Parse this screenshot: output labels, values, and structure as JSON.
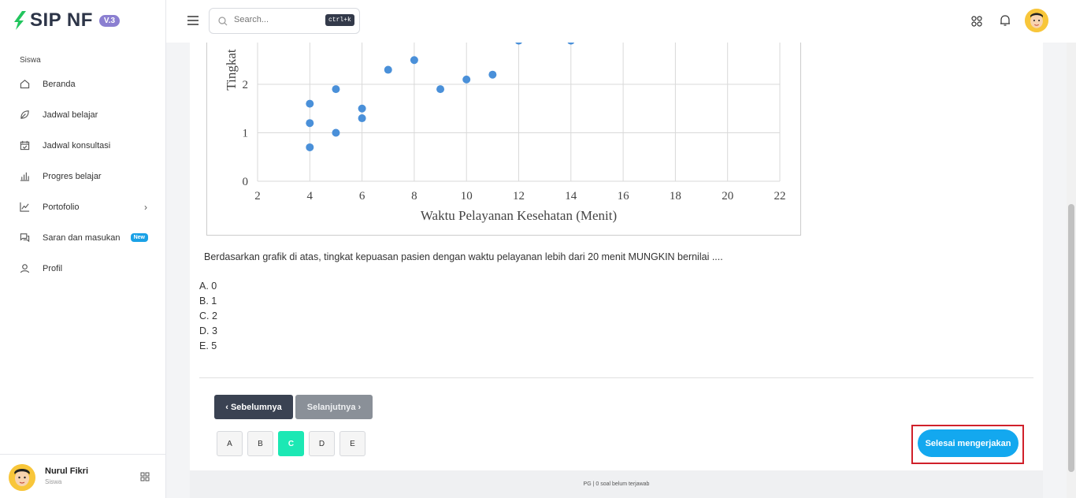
{
  "app": {
    "brand": "SIP NF",
    "version": "V.3"
  },
  "sidebar": {
    "section": "Siswa",
    "items": [
      {
        "label": "Beranda",
        "icon": "home-icon"
      },
      {
        "label": "Jadwal belajar",
        "icon": "leaf-icon"
      },
      {
        "label": "Jadwal konsultasi",
        "icon": "calendar-check-icon"
      },
      {
        "label": "Progres belajar",
        "icon": "bar-chart-icon"
      },
      {
        "label": "Portofolio",
        "icon": "trend-chart-icon"
      },
      {
        "label": "Saran dan masukan",
        "icon": "chat-icon",
        "badge": "New"
      },
      {
        "label": "Profil",
        "icon": "user-icon"
      }
    ],
    "user": {
      "name": "Nurul Fikri",
      "role": "Siswa"
    }
  },
  "topbar": {
    "search_placeholder": "Search...",
    "shortcut": "ctrl+k"
  },
  "question": {
    "text": "Berdasarkan grafik di atas, tingkat kepuasan pasien dengan waktu pelayanan lebih dari 20 menit MUNGKIN bernilai ....",
    "options": [
      "A. 0",
      "B. 1",
      "C. 2",
      "D. 3",
      "E. 5"
    ]
  },
  "nav_buttons": {
    "prev": "Sebelumnya",
    "next": "Selanjutnya"
  },
  "answers": [
    "A",
    "B",
    "C",
    "D",
    "E"
  ],
  "selected_answer": "C",
  "finish_label": "Selesai mengerjakan",
  "footer_status": "PG | 0 soal belum terjawab",
  "colors": {
    "accent": "#13a8ef",
    "selected": "#1ce8b4",
    "dark_button": "#3a4252",
    "point": "#4a90d9"
  },
  "chart_data": {
    "type": "scatter",
    "xlabel": "Waktu Pelayanan Kesehatan (Menit)",
    "ylabel": "Tingkat",
    "xlim": [
      2,
      22
    ],
    "x_ticks": [
      "2",
      "4",
      "6",
      "8",
      "10",
      "12",
      "14",
      "16",
      "18",
      "20",
      "22"
    ],
    "y_ticks": [
      "0",
      "1",
      "2"
    ],
    "grid": true,
    "points": [
      {
        "x": 4,
        "y": 0.7
      },
      {
        "x": 4,
        "y": 1.2
      },
      {
        "x": 4,
        "y": 1.6
      },
      {
        "x": 5,
        "y": 1.0
      },
      {
        "x": 5,
        "y": 1.9
      },
      {
        "x": 6,
        "y": 1.3
      },
      {
        "x": 6,
        "y": 1.5
      },
      {
        "x": 7,
        "y": 2.3
      },
      {
        "x": 8,
        "y": 2.5
      },
      {
        "x": 9,
        "y": 1.9
      },
      {
        "x": 10,
        "y": 2.1
      },
      {
        "x": 11,
        "y": 2.2
      },
      {
        "x": 12,
        "y": 2.9
      },
      {
        "x": 14,
        "y": 2.9
      }
    ]
  }
}
